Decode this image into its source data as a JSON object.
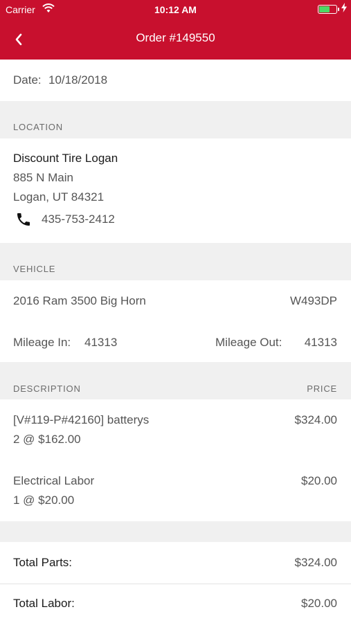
{
  "status_bar": {
    "carrier": "Carrier",
    "time": "10:12 AM"
  },
  "nav": {
    "title": "Order #149550"
  },
  "date": {
    "label": "Date:",
    "value": "10/18/2018"
  },
  "location": {
    "header": "LOCATION",
    "name": "Discount Tire Logan",
    "address1": "885 N Main",
    "address2": "Logan, UT 84321",
    "phone": "435-753-2412"
  },
  "vehicle": {
    "header": "VEHICLE",
    "model": "2016 Ram 3500 Big Horn",
    "plate": "W493DP",
    "mileage_in_label": "Mileage In:",
    "mileage_in": "41313",
    "mileage_out_label": "Mileage Out:",
    "mileage_out": "41313"
  },
  "items": {
    "header_desc": "DESCRIPTION",
    "header_price": "PRICE",
    "list": [
      {
        "name": "[V#119-P#42160] batterys",
        "qty": "2 @ $162.00",
        "price": "$324.00"
      },
      {
        "name": "Electrical Labor",
        "qty": "1 @ $20.00",
        "price": "$20.00"
      }
    ]
  },
  "totals": {
    "parts_label": "Total Parts:",
    "parts": "$324.00",
    "labor_label": "Total Labor:",
    "labor": "$20.00"
  },
  "colors": {
    "accent": "#c8102e",
    "section_bg": "#f0f0f0",
    "battery": "#4cd964"
  }
}
